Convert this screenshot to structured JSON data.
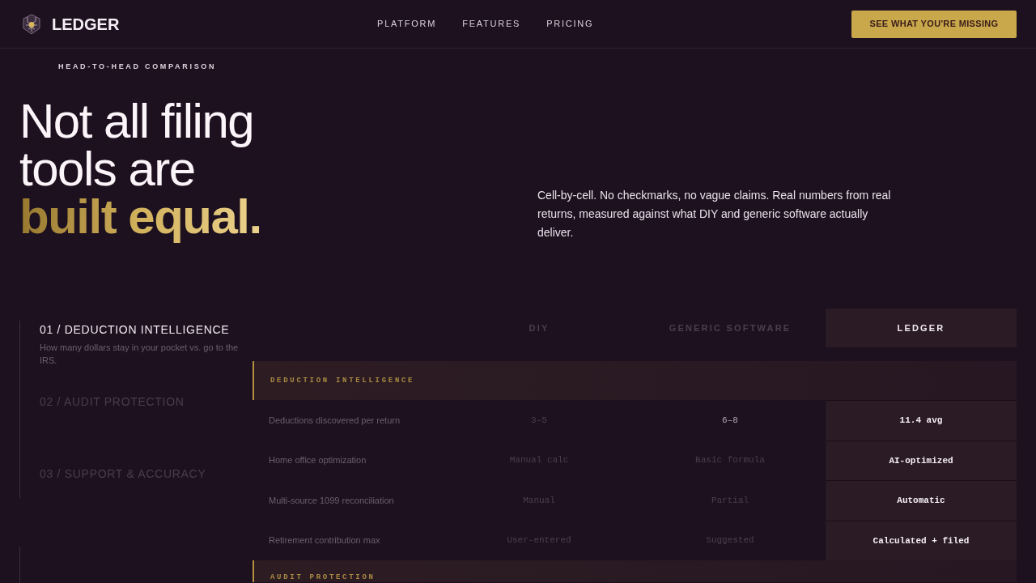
{
  "header": {
    "brand": "LEDGER",
    "nav": [
      {
        "label": "PLATFORM"
      },
      {
        "label": "FEATURES"
      },
      {
        "label": "PRICING"
      }
    ],
    "cta": "SEE WHAT YOU'RE MISSING"
  },
  "hero": {
    "eyebrow": "HEAD-TO-HEAD COMPARISON",
    "headline": "Not all filing tools are **built equal.**",
    "intro": "Cell-by-cell. No checkmarks, no vague claims. Real numbers from real returns, measured against what DIY and generic software actually deliver."
  },
  "comparison": {
    "categories": [
      {
        "label": "01 / DEDUCTION INTELLIGENCE",
        "description": "How many dollars stay in your pocket vs. go to the IRS.",
        "selected": true
      },
      {
        "label": "02 / AUDIT PROTECTION",
        "selected": false
      },
      {
        "label": "03 / SUPPORT & ACCURACY",
        "selected": false
      }
    ],
    "table": {
      "columns": [
        {
          "label": "DIY",
          "highlighted": false
        },
        {
          "label": "GENERIC SOFTWARE",
          "highlighted": false
        },
        {
          "label": "LEDGER",
          "highlighted": true
        }
      ],
      "sections": [
        {
          "title": "DEDUCTION INTELLIGENCE",
          "rows": [
            {
              "label": "Deductions discovered per return",
              "cells": [
                {
                  "value": "3–5",
                  "muted": true
                },
                {
                  "value": "6–8",
                  "muted": false
                },
                {
                  "value": "11.4 avg",
                  "muted": false
                }
              ]
            },
            {
              "label": "Home office optimization",
              "cells": [
                {
                  "value": "Manual calc",
                  "muted": true
                },
                {
                  "value": "Basic formula",
                  "muted": true
                },
                {
                  "value": "AI-optimized",
                  "muted": false
                }
              ]
            },
            {
              "label": "Multi-source 1099 reconciliation",
              "cells": [
                {
                  "value": "Manual",
                  "muted": true
                },
                {
                  "value": "Partial",
                  "muted": true
                },
                {
                  "value": "Automatic",
                  "muted": false
                }
              ]
            },
            {
              "label": "Retirement contribution max",
              "cells": [
                {
                  "value": "User-entered",
                  "muted": true
                },
                {
                  "value": "Suggested",
                  "muted": true
                },
                {
                  "value": "Calculated + filed",
                  "muted": false
                }
              ]
            }
          ]
        },
        {
          "title": "AUDIT PROTECTION"
        }
      ]
    }
  }
}
